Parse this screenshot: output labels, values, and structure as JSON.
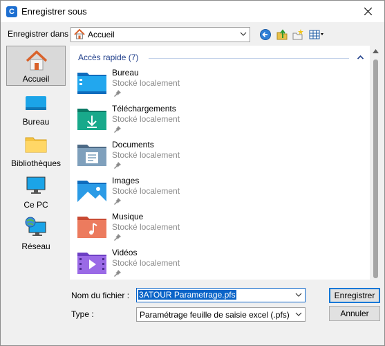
{
  "window": {
    "title": "Enregistrer sous",
    "app_icon_letter": "C"
  },
  "location": {
    "label": "Enregistrer dans :",
    "value": "Accueil"
  },
  "toolbar": {
    "icons": [
      "back-icon",
      "up-folder-icon",
      "new-folder-icon",
      "view-menu-icon"
    ]
  },
  "places": [
    {
      "label": "Accueil",
      "icon": "home-icon",
      "selected": true
    },
    {
      "label": "Bureau",
      "icon": "desktop-icon",
      "selected": false
    },
    {
      "label": "Bibliothèques",
      "icon": "libraries-icon",
      "selected": false
    },
    {
      "label": "Ce PC",
      "icon": "this-pc-icon",
      "selected": false
    },
    {
      "label": "Réseau",
      "icon": "network-icon",
      "selected": false
    }
  ],
  "quick_access": {
    "title": "Accès rapide (7)",
    "items": [
      {
        "name": "Bureau",
        "sub": "Stocké localement",
        "icon": "desktop-folder-icon"
      },
      {
        "name": "Téléchargements",
        "sub": "Stocké localement",
        "icon": "downloads-folder-icon"
      },
      {
        "name": "Documents",
        "sub": "Stocké localement",
        "icon": "documents-folder-icon"
      },
      {
        "name": "Images",
        "sub": "Stocké localement",
        "icon": "pictures-folder-icon"
      },
      {
        "name": "Musique",
        "sub": "Stocké localement",
        "icon": "music-folder-icon"
      },
      {
        "name": "Vidéos",
        "sub": "Stocké localement",
        "icon": "videos-folder-icon"
      }
    ]
  },
  "form": {
    "filename_label": "Nom du fichier :",
    "filename_value": "3ATOUR Parametrage.pfs",
    "type_label": "Type :",
    "type_value": "Paramétrage feuille de saisie excel (.pfs)",
    "save_button": "Enregistrer",
    "cancel_button": "Annuler"
  },
  "colors": {
    "accent": "#0a64c8",
    "group_title": "#1e3d8a"
  }
}
